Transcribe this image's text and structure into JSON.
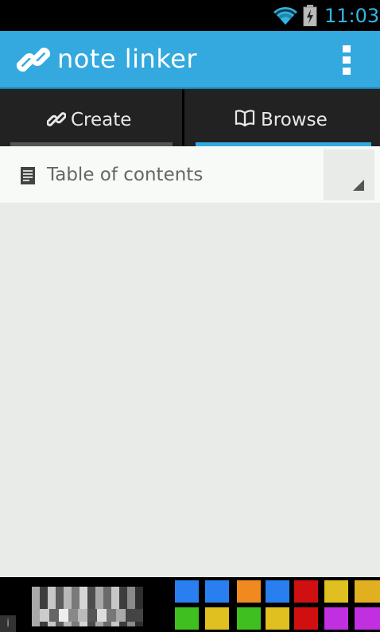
{
  "status_bar": {
    "time": "11:03"
  },
  "app_bar": {
    "title": "note linker"
  },
  "tabs": [
    {
      "label": "Create",
      "selected": false
    },
    {
      "label": "Browse",
      "selected": true
    }
  ],
  "dropdown": {
    "selected_value": "Table of contents"
  },
  "colors": {
    "accent": "#33a9df",
    "status_clock": "#33b5e5",
    "tab_bar": "#222222",
    "content_bg": "#e8ebe8"
  },
  "icons": {
    "status": [
      "wifi-icon",
      "battery-charging-icon"
    ],
    "app_bar": [
      "link-logo-icon",
      "overflow-menu-icon"
    ],
    "tabs": [
      "link-icon",
      "book-icon"
    ],
    "dropdown": [
      "document-icon",
      "dropdown-arrow-icon"
    ]
  }
}
